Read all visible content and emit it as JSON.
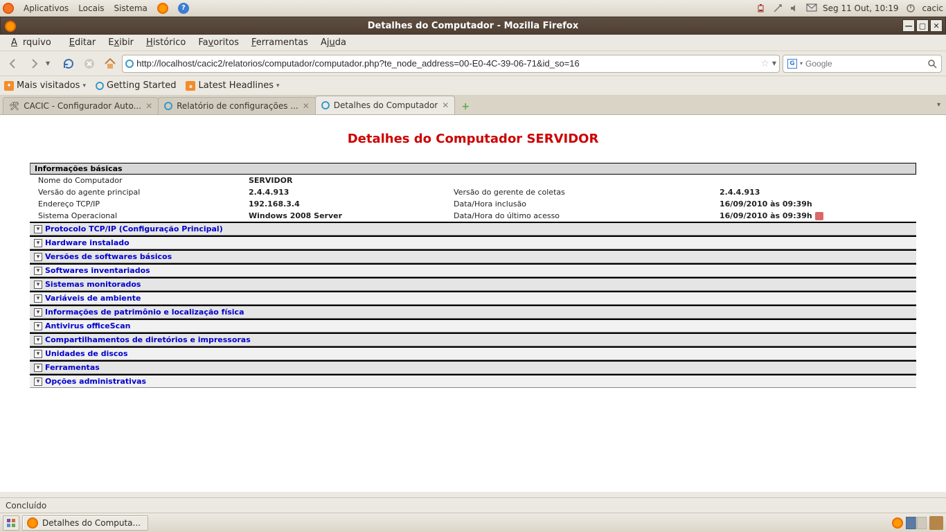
{
  "gnome": {
    "menus": [
      "Aplicativos",
      "Locais",
      "Sistema"
    ],
    "clock": "Seg 11 Out, 10:19",
    "user": "cacic"
  },
  "window": {
    "title": "Detalhes do Computador - Mozilla Firefox"
  },
  "menubar": [
    "Arquivo",
    "Editar",
    "Exibir",
    "Histórico",
    "Favoritos",
    "Ferramentas",
    "Ajuda"
  ],
  "url": "http://localhost/cacic2/relatorios/computador/computador.php?te_node_address=00-E0-4C-39-06-71&id_so=16",
  "search_placeholder": "Google",
  "bookmarks": {
    "most_visited": "Mais visitados",
    "getting_started": "Getting Started",
    "latest_headlines": "Latest Headlines"
  },
  "tabs": [
    {
      "title": "CACIC - Configurador Auto..."
    },
    {
      "title": "Relatório de configurações ..."
    },
    {
      "title": "Detalhes do Computador"
    }
  ],
  "page": {
    "heading": "Detalhes do Computador SERVIDOR",
    "section_basic": "Informações básicas",
    "labels": {
      "nome": "Nome do Computador",
      "versao_agente": "Versão do agente principal",
      "versao_gerente": "Versão do gerente de coletas",
      "endereco": "Endereço TCP/IP",
      "data_inclusao": "Data/Hora inclusão",
      "so": "Sistema Operacional",
      "data_acesso": "Data/Hora do último acesso"
    },
    "values": {
      "nome": "SERVIDOR",
      "versao_agente": "2.4.4.913",
      "versao_gerente": "2.4.4.913",
      "endereco": "192.168.3.4",
      "data_inclusao": "16/09/2010 às 09:39h",
      "so": "Windows 2008 Server",
      "data_acesso": "16/09/2010 às 09:39h"
    },
    "expanders": [
      "Protocolo TCP/IP (Configuração Principal)",
      "Hardware instalado",
      "Versões de softwares básicos",
      "Softwares inventariados",
      "Sistemas monitorados",
      "Variáveis de ambiente",
      "Informações de patrimônio e localização física",
      "Antivirus officeScan",
      "Compartilhamentos de diretórios e impressoras",
      "Unidades de discos",
      "Ferramentas",
      "Opções administrativas"
    ]
  },
  "status": "Concluído",
  "task": "Detalhes do Computa..."
}
